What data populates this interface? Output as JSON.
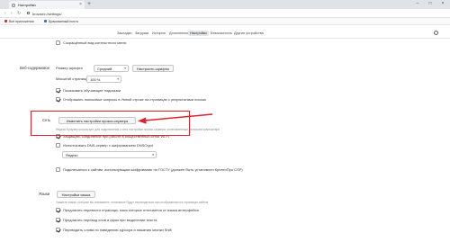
{
  "browser": {
    "tab_title": "Настройки",
    "tab_close": "×",
    "new_tab": "+",
    "window_controls": [
      "–",
      "□",
      "×"
    ],
    "url": "browser://settings/",
    "nav_back": "‹",
    "nav_forward": "›",
    "nav_reload": "↻",
    "bookmarks": [
      {
        "label": "Всё приложения",
        "icon": "gmail-icon",
        "color": "#d93025"
      },
      {
        "label": "Бракованный почта",
        "icon": "bookmark-icon",
        "color": "#1a73e8"
      }
    ]
  },
  "settings_nav": {
    "tabs": [
      {
        "label": "Закладки"
      },
      {
        "label": "Загрузки"
      },
      {
        "label": "История"
      },
      {
        "label": "Дополнения"
      },
      {
        "label": "Настройки",
        "active": true
      },
      {
        "label": "Безопасность"
      },
      {
        "label": "Другие устройства"
      }
    ]
  },
  "content": {
    "top_checkbox": "Сокращённый вид контекстного меню",
    "web_content": {
      "label": "Веб-содержимое",
      "font_size_label": "Размер шрифта",
      "font_size_value": "Средний",
      "customize_fonts_button": "Настроить шрифты",
      "page_zoom_label": "Масштаб страницы",
      "page_zoom_value": "100 %",
      "show_hints": "Показывать обучающие подсказки",
      "show_search_queries": "Отображать поисковые запросы в Умной строке на страницах с результатами поиска"
    },
    "network": {
      "label": "Сеть",
      "proxy_button": "Изменить настройки прокси-сервера",
      "proxy_note": "Яндекс.Браузер использует для подключения к сети настройки прокси-сервера, установленные на вашем компьютере",
      "wifi_protection": "Защищать соединение при работе в общественных сетях Wi-Fi",
      "dns_over_https": "Использовать DNS-сервер с шифрованием DNSCrypt",
      "dns_provider": "Яндекс",
      "gost_connect": "Подключаться к сайтам, использующим шифрование по ГОСТУ (должен быть установлен КриптоПро CSP)"
    },
    "languages": {
      "label": "Языки",
      "settings_button": "Настройки языка",
      "note": "Укажите языки, которые вы понимаете; остальные будут переводиться при отображении на страницах сайтов",
      "translate_pages": "Предлагать перевести страницы, язык которых отличается от языка интерфейса",
      "translate_selection": "Предлагать перевод слов и фраз при выделении текста",
      "translate_hover": "Переводить слова по наведению курсора и нажатию кнопки Shift"
    }
  },
  "annotation": {
    "color": "#e0202a"
  }
}
